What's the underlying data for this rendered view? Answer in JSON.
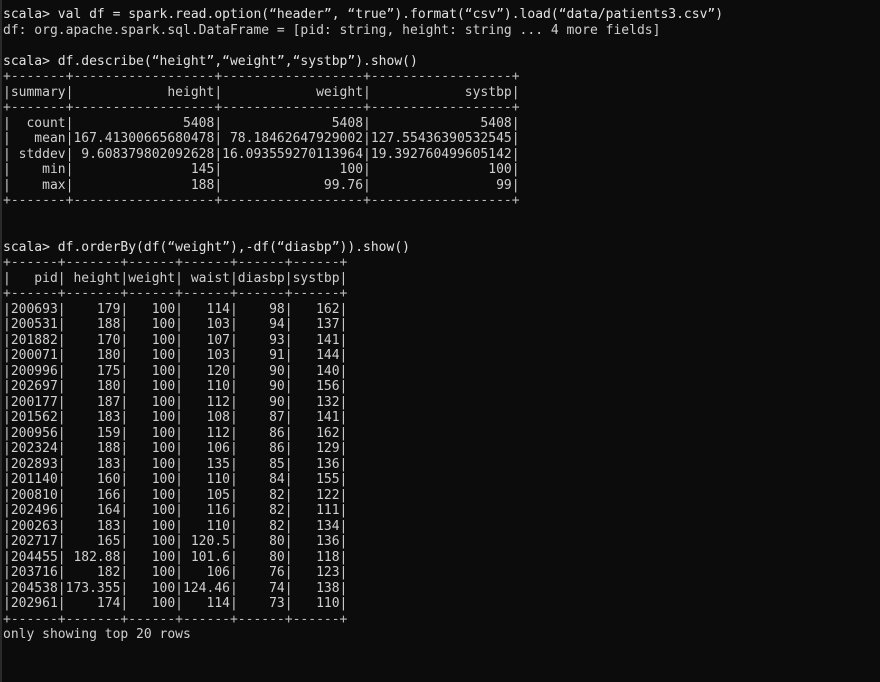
{
  "terminal": {
    "app": "spark-shell",
    "prompt": "scala>",
    "colors": {
      "background": "#0c0c0c",
      "foreground": "#cfcfcf",
      "border": "#2a2a2a"
    }
  },
  "blocks": [
    {
      "kind": "input",
      "name": "command-load-csv",
      "text": "scala> val df = spark.read.option(“header”, “true”).format(“csv”).load(“data/patients3.csv”)"
    },
    {
      "kind": "output",
      "name": "result-dataframe-schema",
      "text": "df: org.apache.spark.sql.DataFrame = [pid: string, height: string ... 4 more fields]"
    },
    {
      "kind": "blank",
      "name": "blank-line-1",
      "text": " "
    },
    {
      "kind": "input",
      "name": "command-describe",
      "text": "scala> df.describe(“height”,“weight”,“systbp”).show()"
    }
  ],
  "describe_table": {
    "name": "describe-output-table",
    "rule_top": "+-------+------------------+------------------+------------------+",
    "rule_mid": "+-------+------------------+------------------+------------------+",
    "rule_bottom": "+-------+------------------+------------------+------------------+",
    "header": "|summary|            height|            weight|            systbp|",
    "columns": [
      "summary",
      "height",
      "weight",
      "systbp"
    ],
    "rows": [
      "|  count|              5408|              5408|              5408|",
      "|   mean|167.41300665680478| 78.18462647929002|127.55436390532545|",
      "| stddev| 9.608379802092628|16.093559270113964|19.392760499605142|",
      "|    min|               145|               100|               100|",
      "|    max|               188|             99.76|                99|"
    ],
    "data": {
      "count": [
        "5408",
        "5408",
        "5408"
      ],
      "mean": [
        "167.41300665680478",
        "78.18462647929002",
        "127.55436390532545"
      ],
      "stddev": [
        "9.608379802092628",
        "16.093559270113964",
        "19.392760499605142"
      ],
      "min": [
        "145",
        "100",
        "100"
      ],
      "max": [
        "188",
        "99.76",
        "99"
      ]
    }
  },
  "blocks2": [
    {
      "kind": "blank",
      "name": "blank-line-2",
      "text": " "
    },
    {
      "kind": "blank",
      "name": "blank-line-3",
      "text": " "
    },
    {
      "kind": "input",
      "name": "command-orderby",
      "text": "scala> df.orderBy(df(“weight”),-df(“diasbp”)).show()"
    }
  ],
  "orderby_table": {
    "name": "orderby-output-table",
    "rule_top": "+------+-------+------+------+------+------+",
    "rule_mid": "+------+-------+------+------+------+------+",
    "rule_bottom": "+------+-------+------+------+------+------+",
    "header": "|   pid| height|weight| waist|diasbp|systbp|",
    "columns": [
      "pid",
      "height",
      "weight",
      "waist",
      "diasbp",
      "systbp"
    ],
    "rows": [
      "|200693|    179|   100|   114|    98|   162|",
      "|200531|    188|   100|   103|    94|   137|",
      "|201882|    170|   100|   107|    93|   141|",
      "|200071|    180|   100|   103|    91|   144|",
      "|200996|    175|   100|   120|    90|   140|",
      "|202697|    180|   100|   110|    90|   156|",
      "|200177|    187|   100|   112|    90|   132|",
      "|201562|    183|   100|   108|    87|   141|",
      "|200956|    159|   100|   112|    86|   162|",
      "|202324|    188|   100|   106|    86|   129|",
      "|202893|    183|   100|   135|    85|   136|",
      "|201140|    160|   100|   110|    84|   155|",
      "|200810|    166|   100|   105|    82|   122|",
      "|202496|    164|   100|   116|    82|   111|",
      "|200263|    183|   100|   110|    82|   134|",
      "|202717|    165|   100| 120.5|    80|   136|",
      "|204455| 182.88|   100| 101.6|    80|   118|",
      "|203716|    182|   100|   106|    76|   123|",
      "|204538|173.355|   100|124.46|    74|   138|",
      "|202961|    174|   100|   114|    73|   110|"
    ],
    "data": [
      [
        "200693",
        "179",
        "100",
        "114",
        "98",
        "162"
      ],
      [
        "200531",
        "188",
        "100",
        "103",
        "94",
        "137"
      ],
      [
        "201882",
        "170",
        "100",
        "107",
        "93",
        "141"
      ],
      [
        "200071",
        "180",
        "100",
        "103",
        "91",
        "144"
      ],
      [
        "200996",
        "175",
        "100",
        "120",
        "90",
        "140"
      ],
      [
        "202697",
        "180",
        "100",
        "110",
        "90",
        "156"
      ],
      [
        "200177",
        "187",
        "100",
        "112",
        "90",
        "132"
      ],
      [
        "201562",
        "183",
        "100",
        "108",
        "87",
        "141"
      ],
      [
        "200956",
        "159",
        "100",
        "112",
        "86",
        "162"
      ],
      [
        "202324",
        "188",
        "100",
        "106",
        "86",
        "129"
      ],
      [
        "202893",
        "183",
        "100",
        "135",
        "85",
        "136"
      ],
      [
        "201140",
        "160",
        "100",
        "110",
        "84",
        "155"
      ],
      [
        "200810",
        "166",
        "100",
        "105",
        "82",
        "122"
      ],
      [
        "202496",
        "164",
        "100",
        "116",
        "82",
        "111"
      ],
      [
        "200263",
        "183",
        "100",
        "110",
        "82",
        "134"
      ],
      [
        "202717",
        "165",
        "100",
        "120.5",
        "80",
        "136"
      ],
      [
        "204455",
        "182.88",
        "100",
        "101.6",
        "80",
        "118"
      ],
      [
        "203716",
        "182",
        "100",
        "106",
        "76",
        "123"
      ],
      [
        "204538",
        "173.355",
        "100",
        "124.46",
        "74",
        "138"
      ],
      [
        "202961",
        "174",
        "100",
        "114",
        "73",
        "110"
      ]
    ]
  },
  "footer": {
    "name": "truncation-notice",
    "text": "only showing top 20 rows"
  }
}
